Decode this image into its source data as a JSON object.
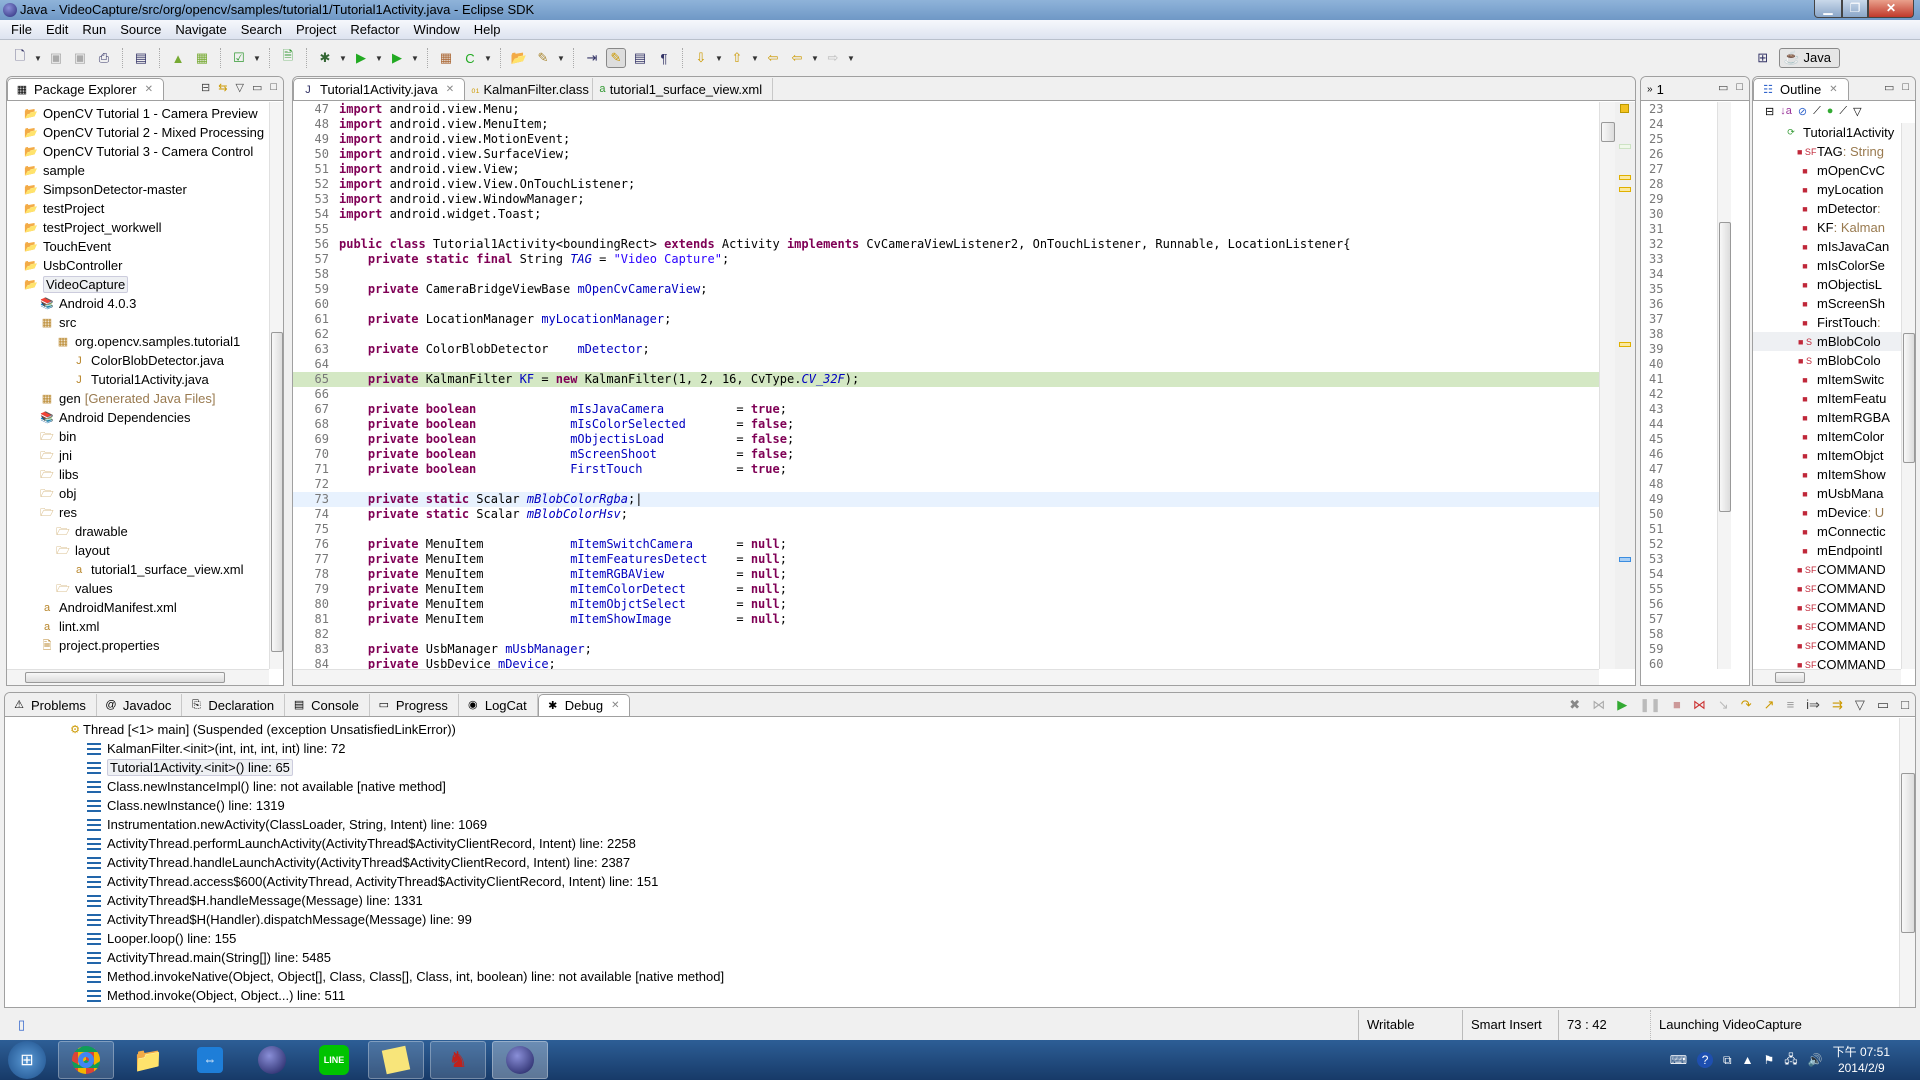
{
  "window": {
    "title": "Java - VideoCapture/src/org/opencv/samples/tutorial1/Tutorial1Activity.java - Eclipse SDK"
  },
  "menu": [
    "File",
    "Edit",
    "Run",
    "Source",
    "Navigate",
    "Search",
    "Project",
    "Refactor",
    "Window",
    "Help"
  ],
  "perspective": {
    "label": "Java"
  },
  "package_explorer": {
    "title": "Package Explorer",
    "items": [
      {
        "label": "OpenCV Tutorial 1 - Camera Preview",
        "depth": 0,
        "icon": "project-icon"
      },
      {
        "label": "OpenCV Tutorial 2 - Mixed Processing",
        "depth": 0,
        "icon": "project-warning-icon"
      },
      {
        "label": "OpenCV Tutorial 3 - Camera Control",
        "depth": 0,
        "icon": "project-icon"
      },
      {
        "label": "sample",
        "depth": 0,
        "icon": "project-icon"
      },
      {
        "label": "SimpsonDetector-master",
        "depth": 0,
        "icon": "project-warning-icon"
      },
      {
        "label": "testProject",
        "depth": 0,
        "icon": "project-error-icon"
      },
      {
        "label": "testProject_workwell",
        "depth": 0,
        "icon": "project-warning-icon"
      },
      {
        "label": "TouchEvent",
        "depth": 0,
        "icon": "project-warning-icon"
      },
      {
        "label": "UsbController",
        "depth": 0,
        "icon": "project-warning-icon"
      },
      {
        "label": "VideoCapture",
        "depth": 0,
        "icon": "project-warning-icon",
        "selected": true
      },
      {
        "label": "Android 4.0.3",
        "depth": 1,
        "icon": "library-icon"
      },
      {
        "label": "src",
        "depth": 1,
        "icon": "source-folder-icon"
      },
      {
        "label": "org.opencv.samples.tutorial1",
        "depth": 2,
        "icon": "package-icon"
      },
      {
        "label": "ColorBlobDetector.java",
        "depth": 3,
        "icon": "java-file-icon"
      },
      {
        "label": "Tutorial1Activity.java",
        "depth": 3,
        "icon": "java-file-warning-icon"
      },
      {
        "label": "gen",
        "suffix": "[Generated Java Files]",
        "depth": 1,
        "icon": "source-folder-icon"
      },
      {
        "label": "Android Dependencies",
        "depth": 1,
        "icon": "library-icon"
      },
      {
        "label": "bin",
        "depth": 1,
        "icon": "folder-icon"
      },
      {
        "label": "jni",
        "depth": 1,
        "icon": "folder-icon"
      },
      {
        "label": "libs",
        "depth": 1,
        "icon": "folder-icon"
      },
      {
        "label": "obj",
        "depth": 1,
        "icon": "folder-icon"
      },
      {
        "label": "res",
        "depth": 1,
        "icon": "folder-icon"
      },
      {
        "label": "drawable",
        "depth": 2,
        "icon": "folder-icon"
      },
      {
        "label": "layout",
        "depth": 2,
        "icon": "folder-icon"
      },
      {
        "label": "tutorial1_surface_view.xml",
        "depth": 3,
        "icon": "xml-file-icon"
      },
      {
        "label": "values",
        "depth": 2,
        "icon": "folder-icon"
      },
      {
        "label": "AndroidManifest.xml",
        "depth": 1,
        "icon": "xml-file-warning-icon"
      },
      {
        "label": "lint.xml",
        "depth": 1,
        "icon": "xml-file-icon"
      },
      {
        "label": "project.properties",
        "depth": 1,
        "icon": "text-file-icon"
      }
    ]
  },
  "editor": {
    "tabs": [
      {
        "label": "Tutorial1Activity.java",
        "active": true
      },
      {
        "label": "KalmanFilter.class",
        "active": false
      },
      {
        "label": "tutorial1_surface_view.xml",
        "active": false
      }
    ],
    "lines": [
      {
        "n": 47,
        "html": "<span class='kw'>import</span> android.view.Menu;"
      },
      {
        "n": 48,
        "html": "<span class='kw'>import</span> android.view.MenuItem;"
      },
      {
        "n": 49,
        "html": "<span class='kw'>import</span> android.view.MotionEvent;"
      },
      {
        "n": 50,
        "html": "<span class='kw'>import</span> android.view.SurfaceView;"
      },
      {
        "n": 51,
        "html": "<span class='kw'>import</span> android.view.View;"
      },
      {
        "n": 52,
        "html": "<span class='kw'>import</span> android.view.View.OnTouchListener;"
      },
      {
        "n": 53,
        "html": "<span class='kw'>import</span> android.view.WindowManager;"
      },
      {
        "n": 54,
        "html": "<span class='kw'>import</span> android.widget.Toast;"
      },
      {
        "n": 55,
        "html": ""
      },
      {
        "n": 56,
        "html": "<span class='kw'>public class</span> Tutorial1Activity&lt;boundingRect&gt; <span class='kw'>extends</span> Activity <span class='kw'>implements</span> CvCameraViewListener2, OnTouchListener, Runnable, LocationListener{"
      },
      {
        "n": 57,
        "html": "    <span class='kw'>private static final</span> String <span class='sfld'>TAG</span> = <span class='str'>\"Video Capture\"</span>;"
      },
      {
        "n": 58,
        "html": ""
      },
      {
        "n": 59,
        "html": "    <span class='kw'>private</span> CameraBridgeViewBase <span class='fld'>mOpenCvCameraView</span>;"
      },
      {
        "n": 60,
        "html": ""
      },
      {
        "n": 61,
        "html": "    <span class='kw'>private</span> LocationManager <span class='fld'>myLocationManager</span>;"
      },
      {
        "n": 62,
        "html": ""
      },
      {
        "n": 63,
        "html": "    <span class='kw'>private</span> ColorBlobDetector    <span class='fld'>mDetector</span>;"
      },
      {
        "n": 64,
        "html": ""
      },
      {
        "n": 65,
        "html": "    <span class='kw'>private</span> KalmanFilter <span class='fld'>KF</span> = <span class='kw'>new</span> KalmanFilter(1, 2, 16, CvType.<span class='sfld'>CV_32F</span>);",
        "cls": "hl65"
      },
      {
        "n": 66,
        "html": ""
      },
      {
        "n": 67,
        "html": "    <span class='kw'>private boolean</span>             <span class='fld'>mIsJavaCamera</span>          = <span class='kw'>true</span>;"
      },
      {
        "n": 68,
        "html": "    <span class='kw'>private boolean</span>             <span class='fld'>mIsColorSelected</span>       = <span class='kw'>false</span>;"
      },
      {
        "n": 69,
        "html": "    <span class='kw'>private boolean</span>             <span class='fld'>mObjectisLoad</span>          = <span class='kw'>false</span>;"
      },
      {
        "n": 70,
        "html": "    <span class='kw'>private boolean</span>             <span class='fld'>mScreenShoot</span>           = <span class='kw'>false</span>;"
      },
      {
        "n": 71,
        "html": "    <span class='kw'>private boolean</span>             <span class='fld'>FirstTouch</span>             = <span class='kw'>true</span>;"
      },
      {
        "n": 72,
        "html": ""
      },
      {
        "n": 73,
        "html": "    <span class='kw'>private static</span> Scalar <span class='sfld'>mBlobColorRgba</span>;|",
        "cls": "cur"
      },
      {
        "n": 74,
        "html": "    <span class='kw'>private static</span> Scalar <span class='sfld'>mBlobColorHsv</span>;"
      },
      {
        "n": 75,
        "html": ""
      },
      {
        "n": 76,
        "html": "    <span class='kw'>private</span> MenuItem            <span class='fld'>mItemSwitchCamera</span>      = <span class='kw'>null</span>;"
      },
      {
        "n": 77,
        "html": "    <span class='kw'>private</span> MenuItem            <span class='fld'>mItemFeaturesDetect</span>    = <span class='kw'>null</span>;"
      },
      {
        "n": 78,
        "html": "    <span class='kw'>private</span> MenuItem            <span class='fld'>mItemRGBAView</span>          = <span class='kw'>null</span>;"
      },
      {
        "n": 79,
        "html": "    <span class='kw'>private</span> MenuItem            <span class='fld'>mItemColorDetect</span>       = <span class='kw'>null</span>;"
      },
      {
        "n": 80,
        "html": "    <span class='kw'>private</span> MenuItem            <span class='fld'>mItemObjctSelect</span>       = <span class='kw'>null</span>;"
      },
      {
        "n": 81,
        "html": "    <span class='kw'>private</span> MenuItem            <span class='fld'>mItemShowImage</span>         = <span class='kw'>null</span>;"
      },
      {
        "n": 82,
        "html": ""
      },
      {
        "n": 83,
        "html": "    <span class='kw'>private</span> UsbManager <span class='fld'>mUsbManager</span>;"
      },
      {
        "n": 84,
        "html": "    <span class='kw'>private</span> UsbDevice <span class='fld'>mDevice</span>;"
      }
    ]
  },
  "mid_view": {
    "tab_label": "1",
    "line_numbers": [
      23,
      24,
      25,
      26,
      27,
      28,
      29,
      30,
      31,
      32,
      33,
      34,
      35,
      36,
      37,
      38,
      39,
      40,
      41,
      42,
      43,
      44,
      45,
      46,
      47,
      48,
      49,
      50,
      51,
      52,
      53,
      54,
      55,
      56,
      57,
      58,
      59,
      60
    ]
  },
  "outline": {
    "title": "Outline",
    "root": "Tutorial1Activity",
    "items": [
      {
        "label": "TAG",
        "type": " : String",
        "icon": "SF"
      },
      {
        "label": "mOpenCvC",
        "icon": ""
      },
      {
        "label": "myLocation",
        "icon": ""
      },
      {
        "label": "mDetector",
        "type": " :",
        "icon": ""
      },
      {
        "label": "KF",
        "type": " : Kalman",
        "icon": ""
      },
      {
        "label": "mIsJavaCan",
        "icon": ""
      },
      {
        "label": "mIsColorSe",
        "icon": ""
      },
      {
        "label": "mObjectisL",
        "icon": ""
      },
      {
        "label": "mScreenSh",
        "icon": ""
      },
      {
        "label": "FirstTouch",
        "type": " :",
        "icon": ""
      },
      {
        "label": "mBlobColo",
        "icon": "S",
        "selected": true
      },
      {
        "label": "mBlobColo",
        "icon": "S"
      },
      {
        "label": "mItemSwitc",
        "icon": ""
      },
      {
        "label": "mItemFeatu",
        "icon": ""
      },
      {
        "label": "mItemRGBA",
        "icon": ""
      },
      {
        "label": "mItemColor",
        "icon": ""
      },
      {
        "label": "mItemObjct",
        "icon": ""
      },
      {
        "label": "mItemShow",
        "icon": ""
      },
      {
        "label": "mUsbMana",
        "icon": ""
      },
      {
        "label": "mDevice",
        "type": " : U",
        "icon": ""
      },
      {
        "label": "mConnectic",
        "icon": ""
      },
      {
        "label": "mEndpointI",
        "icon": ""
      },
      {
        "label": "COMMAND",
        "icon": "SF"
      },
      {
        "label": "COMMAND",
        "icon": "SF"
      },
      {
        "label": "COMMAND",
        "icon": "SF"
      },
      {
        "label": "COMMAND",
        "icon": "SF"
      },
      {
        "label": "COMMAND",
        "icon": "SF"
      },
      {
        "label": "COMMAND",
        "icon": "SF"
      }
    ]
  },
  "bottom": {
    "tabs": [
      {
        "label": "Problems",
        "icon": "problems-icon"
      },
      {
        "label": "Javadoc",
        "icon": "javadoc-icon"
      },
      {
        "label": "Declaration",
        "icon": "declaration-icon"
      },
      {
        "label": "Console",
        "icon": "console-icon"
      },
      {
        "label": "Progress",
        "icon": "progress-icon"
      },
      {
        "label": "LogCat",
        "icon": "logcat-icon"
      },
      {
        "label": "Debug",
        "icon": "debug-icon",
        "active": true
      }
    ],
    "thread": "Thread [<1> main] (Suspended (exception UnsatisfiedLinkError))",
    "frames": [
      "KalmanFilter.<init>(int, int, int, int) line: 72",
      "Tutorial1Activity.<init>() line: 65",
      "Class.newInstanceImpl() line: not available [native method]",
      "Class.newInstance() line: 1319",
      "Instrumentation.newActivity(ClassLoader, String, Intent) line: 1069",
      "ActivityThread.performLaunchActivity(ActivityThread$ActivityClientRecord, Intent) line: 2258",
      "ActivityThread.handleLaunchActivity(ActivityThread$ActivityClientRecord, Intent) line: 2387",
      "ActivityThread.access$600(ActivityThread, ActivityThread$ActivityClientRecord, Intent) line: 151",
      "ActivityThread$H.handleMessage(Message) line: 1331",
      "ActivityThread$H(Handler).dispatchMessage(Message) line: 99",
      "Looper.loop() line: 155",
      "ActivityThread.main(String[]) line: 5485",
      "Method.invokeNative(Object, Object[], Class, Class[], Class, int, boolean) line: not available [native method]",
      "Method.invoke(Object, Object...) line: 511"
    ],
    "selected_frame": 1
  },
  "status": {
    "writable": "Writable",
    "insert_mode": "Smart Insert",
    "position": "73 : 42",
    "task": "Launching VideoCapture"
  },
  "taskbar": {
    "apps": [
      "start-button",
      "chrome",
      "explorer",
      "teamviewer",
      "eclipse",
      "line",
      "sticky-notes",
      "app-red",
      "eclipse-active"
    ],
    "clock_time": "下午 07:51",
    "clock_date": "2014/2/9"
  },
  "colors": {
    "keyword": "#7f0055",
    "field": "#0000c0",
    "string": "#2a00ff",
    "debug_line": "#d4e8c4",
    "current_line": "#e8f2fe"
  }
}
